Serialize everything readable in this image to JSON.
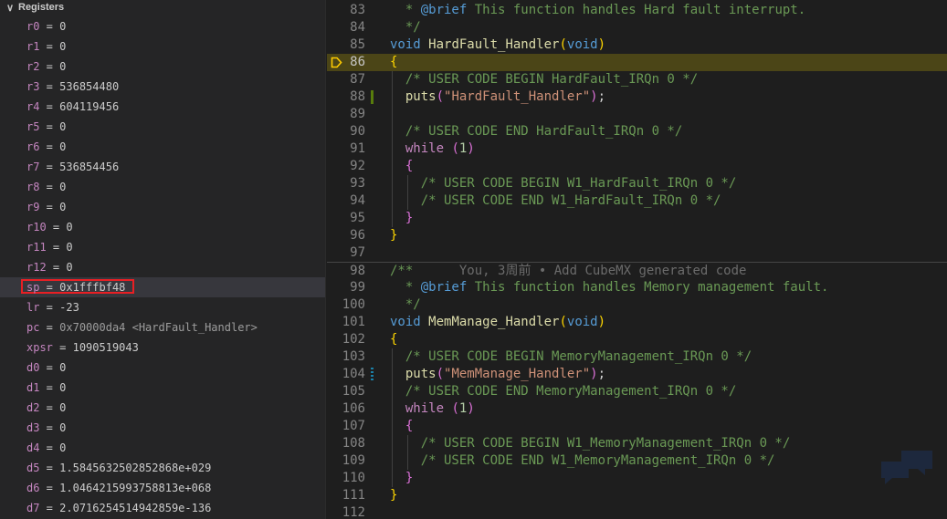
{
  "panel": {
    "title": "Registers",
    "registers": [
      {
        "name": "r0",
        "value": "0"
      },
      {
        "name": "r1",
        "value": "0"
      },
      {
        "name": "r2",
        "value": "0"
      },
      {
        "name": "r3",
        "value": "536854480"
      },
      {
        "name": "r4",
        "value": "604119456"
      },
      {
        "name": "r5",
        "value": "0"
      },
      {
        "name": "r6",
        "value": "0"
      },
      {
        "name": "r7",
        "value": "536854456"
      },
      {
        "name": "r8",
        "value": "0"
      },
      {
        "name": "r9",
        "value": "0"
      },
      {
        "name": "r10",
        "value": "0"
      },
      {
        "name": "r11",
        "value": "0"
      },
      {
        "name": "r12",
        "value": "0"
      },
      {
        "name": "sp",
        "value": "0x1fffbf48"
      },
      {
        "name": "lr",
        "value": "-23"
      },
      {
        "name": "pc",
        "value": "0x70000da4 <HardFault_Handler>"
      },
      {
        "name": "xpsr",
        "value": "1090519043"
      },
      {
        "name": "d0",
        "value": "0"
      },
      {
        "name": "d1",
        "value": "0"
      },
      {
        "name": "d2",
        "value": "0"
      },
      {
        "name": "d3",
        "value": "0"
      },
      {
        "name": "d4",
        "value": "0"
      },
      {
        "name": "d5",
        "value": "1.5845632502852868e+029"
      },
      {
        "name": "d6",
        "value": "1.0464215993758813e+068"
      },
      {
        "name": "d7",
        "value": "2.0716254514942859e-136"
      }
    ]
  },
  "editor": {
    "lines": [
      {
        "no": "83",
        "tokens": [
          [
            "cm",
            "  * "
          ],
          [
            "doc",
            "@brief"
          ],
          [
            "cm",
            " This function handles Hard fault interrupt."
          ]
        ]
      },
      {
        "no": "84",
        "tokens": [
          [
            "cm",
            "  */"
          ]
        ]
      },
      {
        "no": "85",
        "tokens": [
          [
            "kw",
            "void"
          ],
          [
            "pun",
            " "
          ],
          [
            "fn",
            "HardFault_Handler"
          ],
          [
            "br1",
            "("
          ],
          [
            "kw",
            "void"
          ],
          [
            "br1",
            ")"
          ]
        ]
      },
      {
        "no": "86",
        "tokens": [
          [
            "br1",
            "{"
          ]
        ]
      },
      {
        "no": "87",
        "tokens": [
          [
            "cm",
            "  /* USER CODE BEGIN HardFault_IRQn 0 */"
          ]
        ]
      },
      {
        "no": "88",
        "tokens": [
          [
            "pun",
            "  "
          ],
          [
            "fn",
            "puts"
          ],
          [
            "br2",
            "("
          ],
          [
            "str",
            "\"HardFault_Handler\""
          ],
          [
            "br2",
            ")"
          ],
          [
            "pun",
            ";"
          ]
        ]
      },
      {
        "no": "89",
        "tokens": []
      },
      {
        "no": "90",
        "tokens": [
          [
            "cm",
            "  /* USER CODE END HardFault_IRQn 0 */"
          ]
        ]
      },
      {
        "no": "91",
        "tokens": [
          [
            "pun",
            "  "
          ],
          [
            "kw2",
            "while"
          ],
          [
            "pun",
            " "
          ],
          [
            "br2",
            "("
          ],
          [
            "num",
            "1"
          ],
          [
            "br2",
            ")"
          ]
        ]
      },
      {
        "no": "92",
        "tokens": [
          [
            "pun",
            "  "
          ],
          [
            "br2",
            "{"
          ]
        ]
      },
      {
        "no": "93",
        "tokens": [
          [
            "cm",
            "    /* USER CODE BEGIN W1_HardFault_IRQn 0 */"
          ]
        ]
      },
      {
        "no": "94",
        "tokens": [
          [
            "cm",
            "    /* USER CODE END W1_HardFault_IRQn 0 */"
          ]
        ]
      },
      {
        "no": "95",
        "tokens": [
          [
            "pun",
            "  "
          ],
          [
            "br2",
            "}"
          ]
        ]
      },
      {
        "no": "96",
        "tokens": [
          [
            "br1",
            "}"
          ]
        ]
      },
      {
        "no": "97",
        "tokens": []
      },
      {
        "no": "98",
        "tokens": [
          [
            "cm",
            "/**"
          ],
          [
            "blame",
            "      You, 3周前 • Add CubeMX generated code"
          ]
        ]
      },
      {
        "no": "99",
        "tokens": [
          [
            "cm",
            "  * "
          ],
          [
            "doc",
            "@brief"
          ],
          [
            "cm",
            " This function handles Memory management fault."
          ]
        ]
      },
      {
        "no": "100",
        "tokens": [
          [
            "cm",
            "  */"
          ]
        ]
      },
      {
        "no": "101",
        "tokens": [
          [
            "kw",
            "void"
          ],
          [
            "pun",
            " "
          ],
          [
            "fn",
            "MemManage_Handler"
          ],
          [
            "br1",
            "("
          ],
          [
            "kw",
            "void"
          ],
          [
            "br1",
            ")"
          ]
        ]
      },
      {
        "no": "102",
        "tokens": [
          [
            "br1",
            "{"
          ]
        ]
      },
      {
        "no": "103",
        "tokens": [
          [
            "cm",
            "  /* USER CODE BEGIN MemoryManagement_IRQn 0 */"
          ]
        ]
      },
      {
        "no": "104",
        "tokens": [
          [
            "pun",
            "  "
          ],
          [
            "fn",
            "puts"
          ],
          [
            "br2",
            "("
          ],
          [
            "str",
            "\"MemManage_Handler\""
          ],
          [
            "br2",
            ")"
          ],
          [
            "pun",
            ";"
          ]
        ]
      },
      {
        "no": "105",
        "tokens": [
          [
            "cm",
            "  /* USER CODE END MemoryManagement_IRQn 0 */"
          ]
        ]
      },
      {
        "no": "106",
        "tokens": [
          [
            "pun",
            "  "
          ],
          [
            "kw2",
            "while"
          ],
          [
            "pun",
            " "
          ],
          [
            "br2",
            "("
          ],
          [
            "num",
            "1"
          ],
          [
            "br2",
            ")"
          ]
        ]
      },
      {
        "no": "107",
        "tokens": [
          [
            "pun",
            "  "
          ],
          [
            "br2",
            "{"
          ]
        ]
      },
      {
        "no": "108",
        "tokens": [
          [
            "cm",
            "    /* USER CODE BEGIN W1_MemoryManagement_IRQn 0 */"
          ]
        ]
      },
      {
        "no": "109",
        "tokens": [
          [
            "cm",
            "    /* USER CODE END W1_MemoryManagement_IRQn 0 */"
          ]
        ]
      },
      {
        "no": "110",
        "tokens": [
          [
            "pun",
            "  "
          ],
          [
            "br2",
            "}"
          ]
        ]
      },
      {
        "no": "111",
        "tokens": [
          [
            "br1",
            "}"
          ]
        ]
      },
      {
        "no": "112",
        "tokens": []
      }
    ]
  }
}
